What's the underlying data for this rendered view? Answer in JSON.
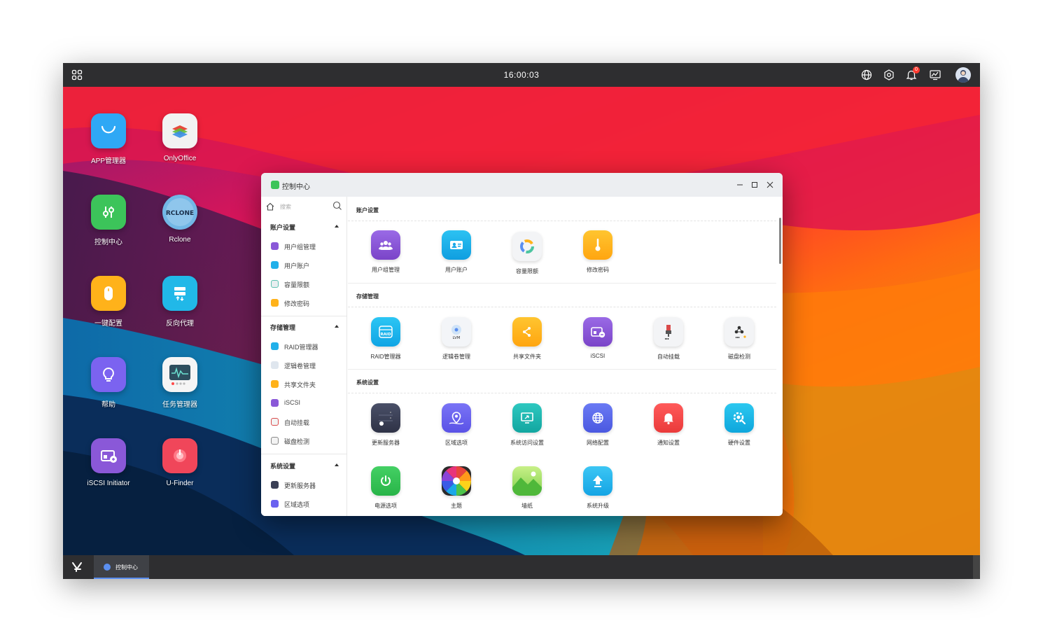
{
  "topbar": {
    "clock": "16:00:03",
    "notification_count": "0"
  },
  "desktop_icons": [
    {
      "label": "APP管理器",
      "icon": "app-store-icon",
      "color": "#2fa8f5"
    },
    {
      "label": "OnlyOffice",
      "icon": "onlyoffice-icon",
      "color": "#f2f2f2"
    },
    {
      "label": "控制中心",
      "icon": "control-center-icon",
      "color": "#3cc45a"
    },
    {
      "label": "Rclone",
      "icon": "rclone-icon",
      "color": "#72b7e6"
    },
    {
      "label": "一键配置",
      "icon": "mouse-icon",
      "color": "#ffb21a"
    },
    {
      "label": "反向代理",
      "icon": "reverse-proxy-icon",
      "color": "#21b8e8"
    },
    {
      "label": "帮助",
      "icon": "help-bulb-icon",
      "color": "#7b63f0"
    },
    {
      "label": "任务管理器",
      "icon": "task-monitor-icon",
      "color": "#f5f5f5"
    },
    {
      "label": "iSCSI Initiator",
      "icon": "iscsi-initiator-icon",
      "color": "#8a58d8"
    },
    {
      "label": "U-Finder",
      "icon": "ufinder-icon",
      "color": "#f0465a"
    }
  ],
  "window": {
    "title": "控制中心",
    "search_placeholder": "搜索"
  },
  "sidebar": {
    "groups": [
      {
        "title": "账户设置",
        "items": [
          {
            "label": "用户组管理",
            "color": "#8a58d8"
          },
          {
            "label": "用户账户",
            "color": "#21b0ea"
          },
          {
            "label": "容量限额",
            "color": "#5bc0b0"
          },
          {
            "label": "修改密码",
            "color": "#ffb21a"
          }
        ]
      },
      {
        "title": "存储管理",
        "items": [
          {
            "label": "RAID管理器",
            "color": "#21b0ea"
          },
          {
            "label": "逻辑卷管理",
            "color": "#9bb0c8"
          },
          {
            "label": "共享文件夹",
            "color": "#ffb21a"
          },
          {
            "label": "iSCSI",
            "color": "#8a58d8"
          },
          {
            "label": "自动挂载",
            "color": "#d94a4a"
          },
          {
            "label": "磁盘检测",
            "color": "#888888"
          }
        ]
      },
      {
        "title": "系统设置",
        "items": [
          {
            "label": "更新服务器",
            "color": "#3a3f55"
          },
          {
            "label": "区域选项",
            "color": "#6a62f0"
          }
        ]
      }
    ]
  },
  "main": {
    "sections": [
      {
        "title": "账户设置",
        "apps": [
          {
            "label": "用户组管理",
            "icon": "user-group-icon"
          },
          {
            "label": "用户账户",
            "icon": "user-account-icon"
          },
          {
            "label": "容量限额",
            "icon": "quota-icon"
          },
          {
            "label": "修改密码",
            "icon": "password-icon"
          }
        ]
      },
      {
        "title": "存储管理",
        "apps": [
          {
            "label": "RAID管理器",
            "icon": "raid-icon",
            "badge": "RAID"
          },
          {
            "label": "逻辑卷管理",
            "icon": "lvm-icon",
            "badge": "LVM"
          },
          {
            "label": "共享文件夹",
            "icon": "shared-folder-icon"
          },
          {
            "label": "iSCSI",
            "icon": "iscsi-icon"
          },
          {
            "label": "自动挂载",
            "icon": "auto-mount-icon"
          },
          {
            "label": "磁盘检测",
            "icon": "disk-check-icon"
          }
        ]
      },
      {
        "title": "系统设置",
        "apps": [
          {
            "label": "更新服务器",
            "icon": "update-server-icon"
          },
          {
            "label": "区域选项",
            "icon": "region-icon"
          },
          {
            "label": "系统访问设置",
            "icon": "system-access-icon"
          },
          {
            "label": "网络配置",
            "icon": "network-icon"
          },
          {
            "label": "通知设置",
            "icon": "notification-icon"
          },
          {
            "label": "硬件设置",
            "icon": "hardware-icon"
          },
          {
            "label": "电源选项",
            "icon": "power-icon"
          },
          {
            "label": "主题",
            "icon": "theme-icon"
          },
          {
            "label": "墙纸",
            "icon": "wallpaper-icon"
          },
          {
            "label": "系统升级",
            "icon": "system-upgrade-icon"
          }
        ]
      }
    ]
  },
  "taskbar": {
    "tasks": [
      {
        "label": "控制中心"
      }
    ]
  },
  "colors": {
    "accent": "#5b8ff0",
    "bar": "#2e2e30"
  }
}
